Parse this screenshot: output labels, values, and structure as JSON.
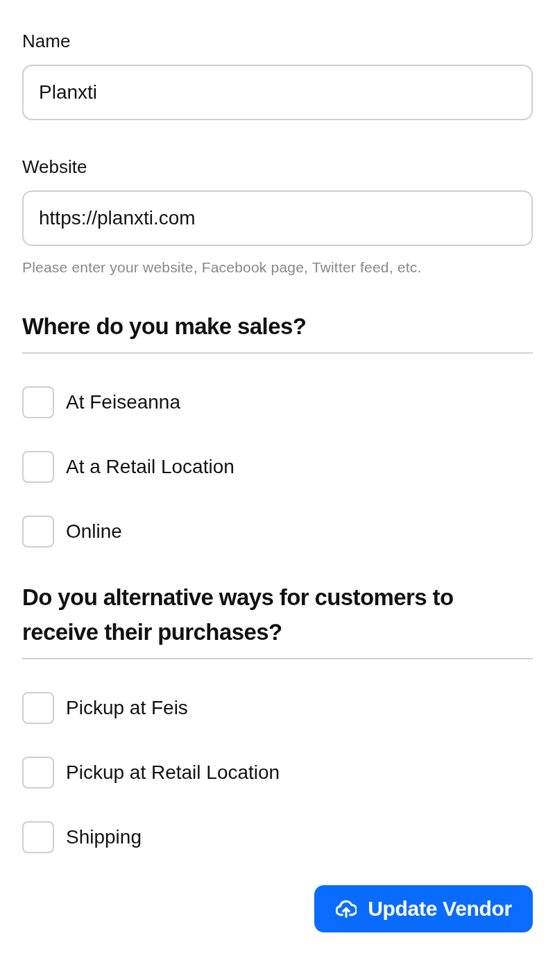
{
  "fields": [
    {
      "label": "Name",
      "value": "Planxti"
    },
    {
      "label": "Website",
      "value": "https://planxti.com",
      "help": "Please enter your website, Facebook page, Twitter feed, etc."
    }
  ],
  "sections": [
    {
      "heading": "Where do you make sales?",
      "options": [
        {
          "label": "At Feiseanna",
          "checked": false
        },
        {
          "label": "At a Retail Location",
          "checked": false
        },
        {
          "label": "Online",
          "checked": false
        }
      ]
    },
    {
      "heading": "Do you alternative ways for customers to receive their purchases?",
      "options": [
        {
          "label": "Pickup at Feis",
          "checked": false
        },
        {
          "label": "Pickup at Retail Location",
          "checked": false
        },
        {
          "label": "Shipping",
          "checked": false
        }
      ]
    }
  ],
  "submit_button": {
    "label": "Update Vendor"
  }
}
